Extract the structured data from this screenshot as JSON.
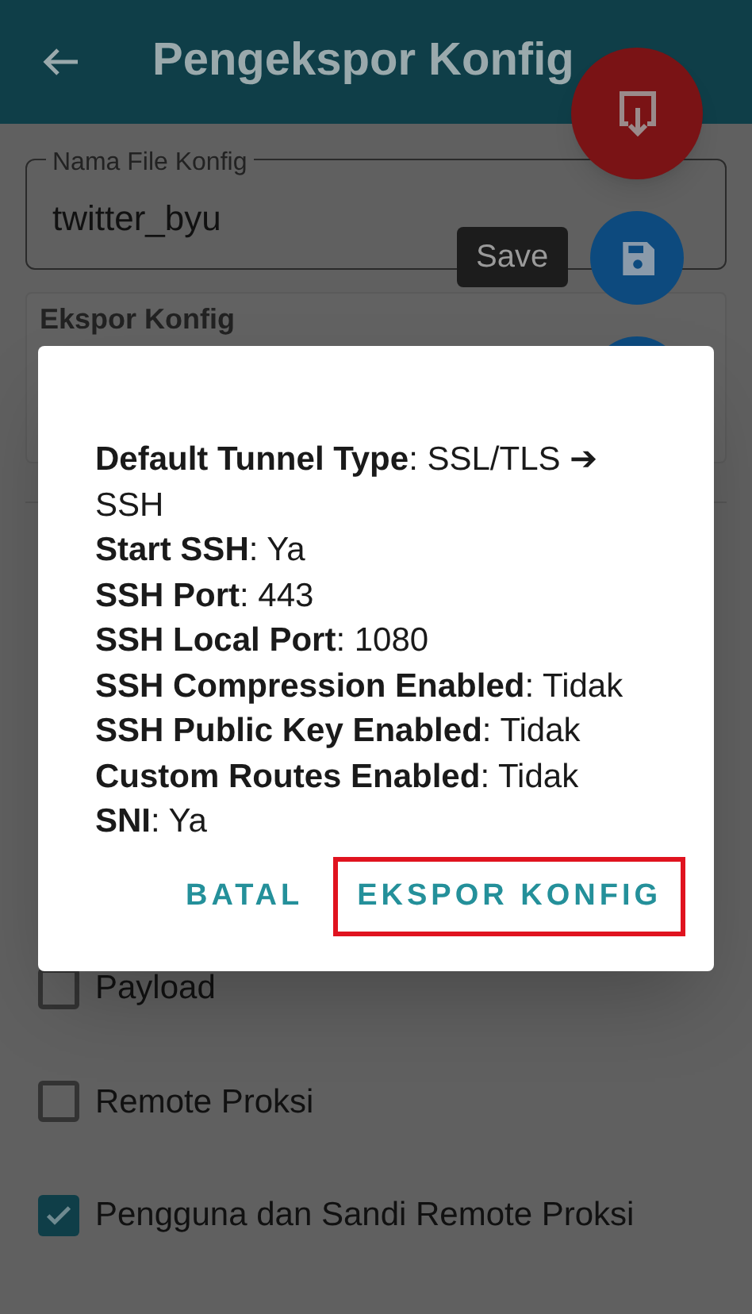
{
  "app_bar": {
    "title": "Pengekspor Konfig"
  },
  "config_name_field": {
    "label": "Nama File Konfig",
    "value": "twitter_byu"
  },
  "tooltip": "Save",
  "export_card": {
    "title": "Ekspor Konfig"
  },
  "options": [
    {
      "label": "Payload",
      "checked": false
    },
    {
      "label": "Remote Proksi",
      "checked": false
    },
    {
      "label": "Pengguna dan Sandi Remote Proksi",
      "checked": true
    }
  ],
  "dialog": {
    "lines": [
      "**Default Tunnel Type**: SSL/TLS ➔ SSH",
      "**Start SSH**: Ya",
      "**SSH Port**: 443",
      "**SSH Local Port**: 1080",
      "**SSH Compression Enabled**: Tidak",
      "**SSH Public Key Enabled**: Tidak",
      "**Custom Routes Enabled**: Tidak",
      "**SNI**: Ya"
    ],
    "buttons": [
      {
        "label": "BATAL",
        "highlighted": false
      },
      {
        "label": "EKSPOR KONFIG",
        "highlighted": true
      }
    ]
  }
}
